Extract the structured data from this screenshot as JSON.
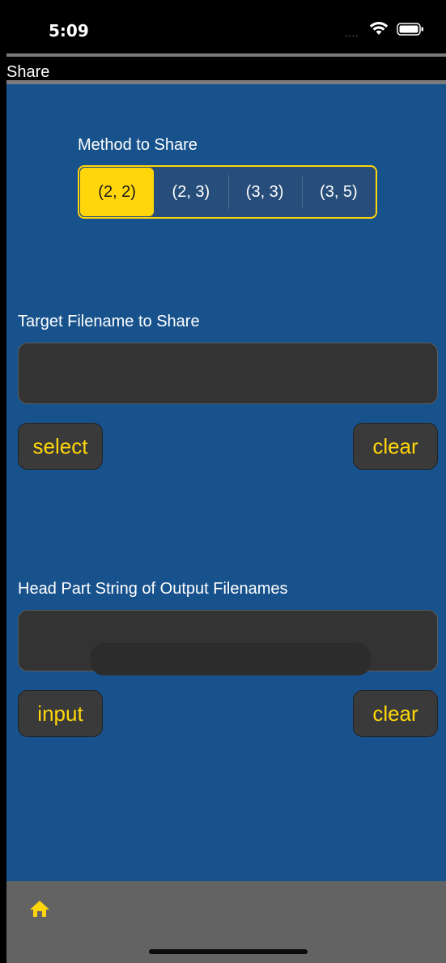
{
  "status": {
    "time": "5:09"
  },
  "nav": {
    "title": "Share"
  },
  "method": {
    "label": "Method to Share",
    "options": [
      "(2, 2)",
      "(2, 3)",
      "(3, 3)",
      "(3, 5)"
    ],
    "selected_index": 0
  },
  "target": {
    "label": "Target Filename to Share",
    "value": "",
    "select_label": "select",
    "clear_label": "clear"
  },
  "head": {
    "label": "Head Part String of Output Filenames",
    "value": "",
    "input_label": "input",
    "clear_label": "clear"
  },
  "tabbar": {
    "home_icon": "home-icon"
  },
  "colors": {
    "accent": "#ffd60a",
    "background": "#18528c",
    "field": "#333333",
    "tabbar": "#636363"
  }
}
